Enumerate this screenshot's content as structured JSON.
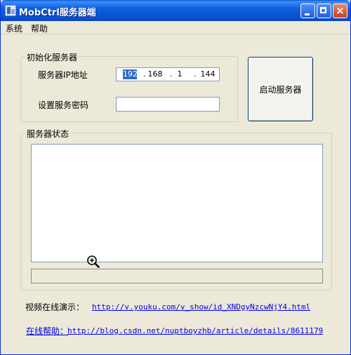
{
  "window": {
    "title": "MobCtrl服务器端",
    "close_glyph": "×"
  },
  "menu": {
    "items": [
      {
        "label": "系统"
      },
      {
        "label": "帮助"
      }
    ]
  },
  "init_group": {
    "legend": "初始化服务器",
    "ip_label": "服务器IP地址",
    "ip_octets": [
      "192",
      "168",
      "1",
      "144"
    ],
    "ip_separator": ".",
    "password_label": "设置服务密码",
    "password_value": ""
  },
  "start_button": {
    "label": "启动服务器"
  },
  "status_group": {
    "legend": "服务器状态",
    "log_text": "",
    "progress_fraction": 0
  },
  "links": {
    "video_label": "视频在线演示：",
    "video_url": "http://v.youku.com/v_show/id_XNDgyNzcwNjY4.html",
    "help_label": "在线帮助：",
    "help_url": "http://blog.csdn.net/nuptboyzhb/article/details/8611179"
  },
  "colors": {
    "title_bar": "#0a4fd0",
    "face": "#ece9d8",
    "link": "#0000ee",
    "selection": "#316ac5"
  }
}
